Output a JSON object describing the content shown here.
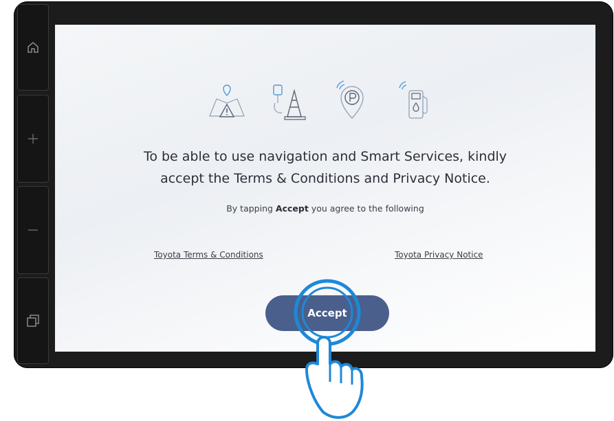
{
  "sidebar": {
    "buttons": [
      {
        "name": "home",
        "icon": "home-icon"
      },
      {
        "name": "volume-up",
        "icon": "plus-icon"
      },
      {
        "name": "volume-down",
        "icon": "minus-icon"
      },
      {
        "name": "multitask",
        "icon": "overlapping-squares-icon"
      }
    ]
  },
  "screen": {
    "feature_icons": [
      "map-warning-icon",
      "traffic-cone-icon",
      "parking-location-icon",
      "fuel-station-icon"
    ],
    "headline_line1": "To be able to use navigation and Smart Services, kindly",
    "headline_line2": "accept the Terms & Conditions and Privacy Notice.",
    "subline_prefix": "By tapping ",
    "subline_bold": "Accept",
    "subline_suffix": " you agree to the following",
    "terms_link": "Toyota Terms & Conditions",
    "privacy_link": "Toyota Privacy Notice",
    "accept_button": "Accept"
  },
  "colors": {
    "accent": "#4a5f8c",
    "highlight": "#1e88d8",
    "device_frame": "#1c1c1c"
  }
}
